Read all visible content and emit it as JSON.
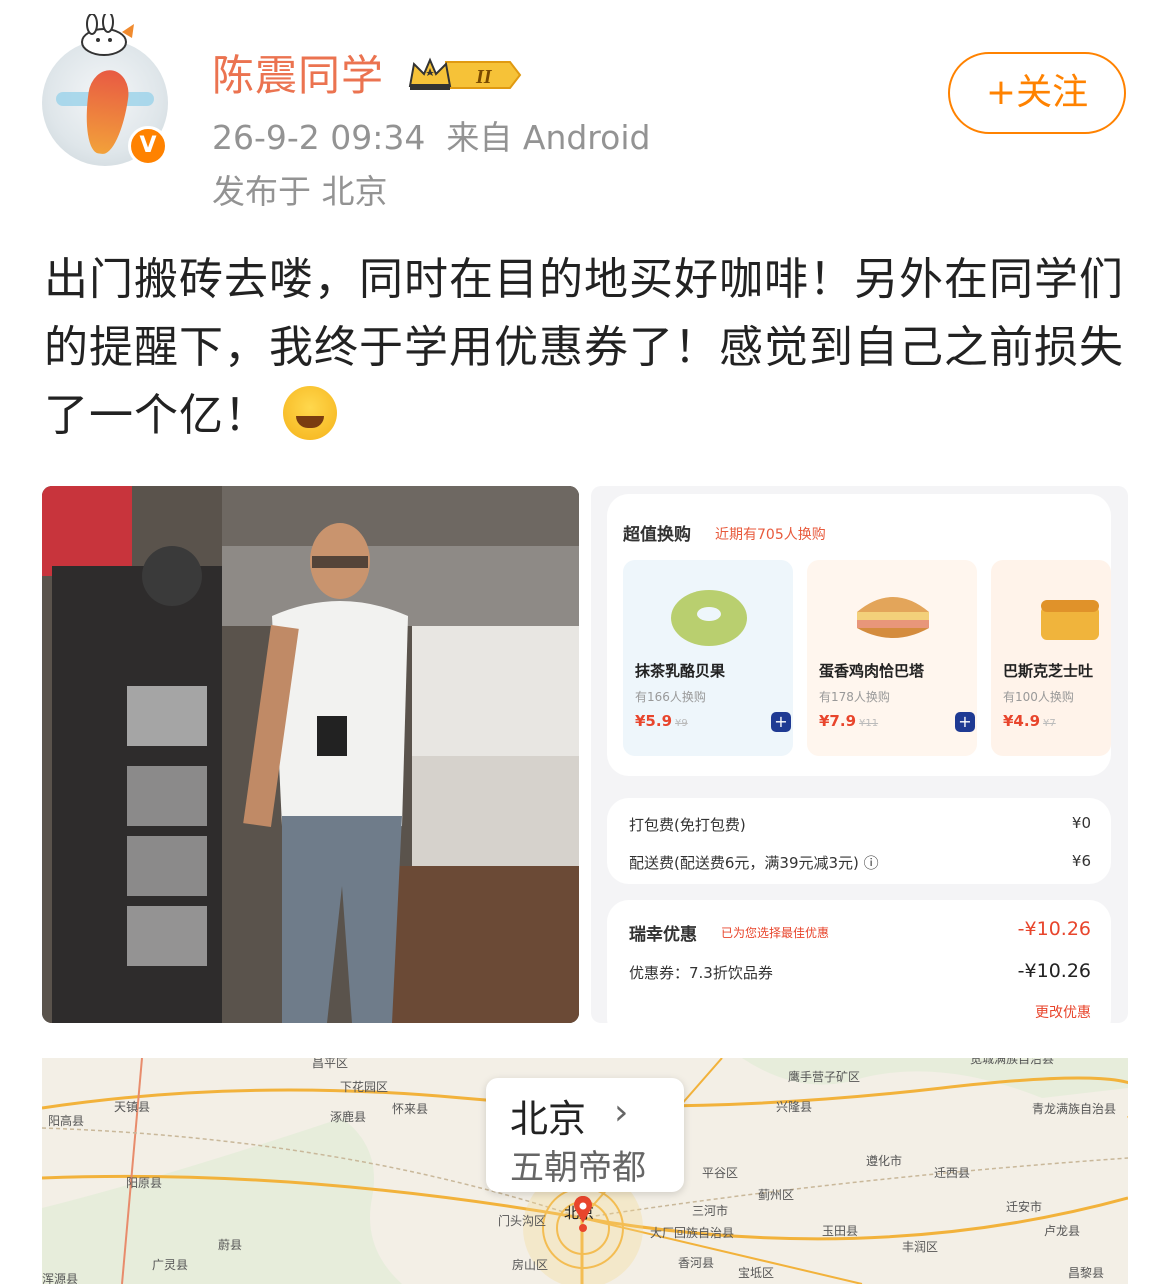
{
  "user": {
    "name": "陈震同学",
    "level_badge": "II",
    "verified_mark": "V",
    "time": "26-9-2 09:34",
    "source": "来自 Android",
    "location": "发布于 北京",
    "follow_label": "+关注"
  },
  "post": {
    "text": "出门搬砖去喽，同时在目的地买好咖啡！另外在同学们的提醒下，我终于学用优惠券了！感觉到自己之前损失了一个亿！",
    "emoji": "laughing-crying"
  },
  "order_screenshot": {
    "section_title": "超值换购",
    "section_sub": "近期有705人换购",
    "products": [
      {
        "name": "抹茶乳酪贝果",
        "count": "有166人换购",
        "price": "¥5.9",
        "orig": "¥9"
      },
      {
        "name": "蛋香鸡肉恰巴塔",
        "count": "有178人换购",
        "price": "¥7.9",
        "orig": "¥11"
      },
      {
        "name": "巴斯克芝士吐",
        "count": "有100人换购",
        "price": "¥4.9",
        "orig": "¥7"
      }
    ],
    "fees": [
      {
        "label": "打包费(免打包费)",
        "value": "¥0"
      },
      {
        "label": "配送费(配送费6元，满39元减3元) ⓘ",
        "value": "¥6"
      }
    ],
    "discount_title": "瑞幸优惠",
    "discount_note": "已为您选择最佳优惠",
    "discount_value": "-¥10.26",
    "coupon_label": "优惠券：7.3折饮品券",
    "coupon_value": "-¥10.26",
    "change_label": "更改优惠"
  },
  "map": {
    "city": "北京",
    "subtitle": "五朝帝都",
    "pin_label": "北京",
    "labels": [
      "昌平区",
      "下花园区",
      "怀来县",
      "涿鹿县",
      "天镇县",
      "阳高县",
      "阳原县",
      "广灵县",
      "蔚县",
      "浑源县",
      "门头沟区",
      "房山区",
      "鹰手营子矿区",
      "兴隆县",
      "宽城满族自治县",
      "青龙满族自治县",
      "遵化市",
      "迁西县",
      "平谷区",
      "三河市",
      "蓟州区",
      "大厂回族自治县",
      "玉田县",
      "丰润区",
      "迁安市",
      "卢龙县",
      "香河县",
      "宝坻区",
      "昌黎县"
    ]
  }
}
